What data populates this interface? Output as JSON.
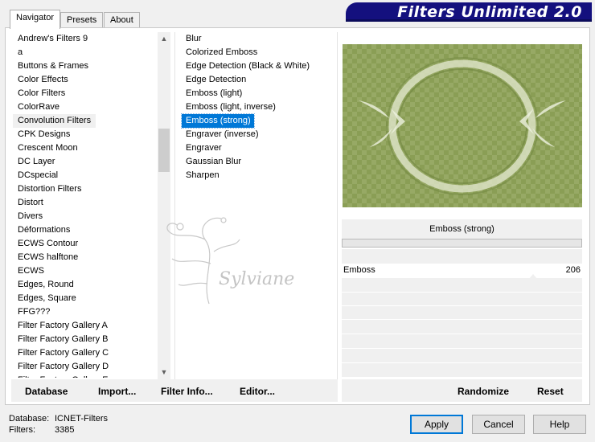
{
  "window": {
    "banner_title": "Filters Unlimited 2.0"
  },
  "tabs": [
    {
      "label": "Navigator",
      "active": true
    },
    {
      "label": "Presets",
      "active": false
    },
    {
      "label": "About",
      "active": false
    }
  ],
  "categories": [
    "Andrew's Filters 9",
    "a",
    "Buttons & Frames",
    "Color Effects",
    "Color Filters",
    "ColorRave",
    "Convolution Filters",
    "CPK Designs",
    "Crescent Moon",
    "DC Layer",
    "DCspecial",
    "Distortion Filters",
    "Distort",
    "Divers",
    "Déformations",
    "ECWS Contour",
    "ECWS halftone",
    "ECWS",
    "Edges, Round",
    "Edges, Square",
    "FFG???",
    "Filter Factory Gallery A",
    "Filter Factory Gallery B",
    "Filter Factory Gallery C",
    "Filter Factory Gallery D",
    "Filter Factory Gallery E"
  ],
  "selected_category": "Convolution Filters",
  "filters": [
    "Blur",
    "Colorized Emboss",
    "Edge Detection (Black & White)",
    "Edge Detection",
    "Emboss (light)",
    "Emboss (light, inverse)",
    "Emboss (strong)",
    "Engraver (inverse)",
    "Engraver",
    "Gaussian Blur",
    "Sharpen"
  ],
  "selected_filter": "Emboss (strong)",
  "watermark_text": "Sylviane",
  "preview": {
    "filter_name": "Emboss (strong)"
  },
  "parameters": [
    {
      "label": "Emboss",
      "value": "206"
    }
  ],
  "parameter_value_fraction": 0.81,
  "left_buttons": {
    "database": "Database",
    "import": "Import...",
    "filter_info": "Filter Info...",
    "editor": "Editor..."
  },
  "right_buttons": {
    "randomize": "Randomize",
    "reset": "Reset"
  },
  "status": {
    "database_label": "Database:",
    "database_value": "ICNET-Filters",
    "filters_label": "Filters:",
    "filters_value": "3385"
  },
  "dialog_buttons": {
    "apply": "Apply",
    "cancel": "Cancel",
    "help": "Help"
  },
  "colors": {
    "banner": "#14107e",
    "selection": "#0078d7",
    "preview_bg": "#8a9e55"
  },
  "icons": {
    "scroll_up": "chevron-up-icon",
    "scroll_down": "chevron-down-icon"
  }
}
